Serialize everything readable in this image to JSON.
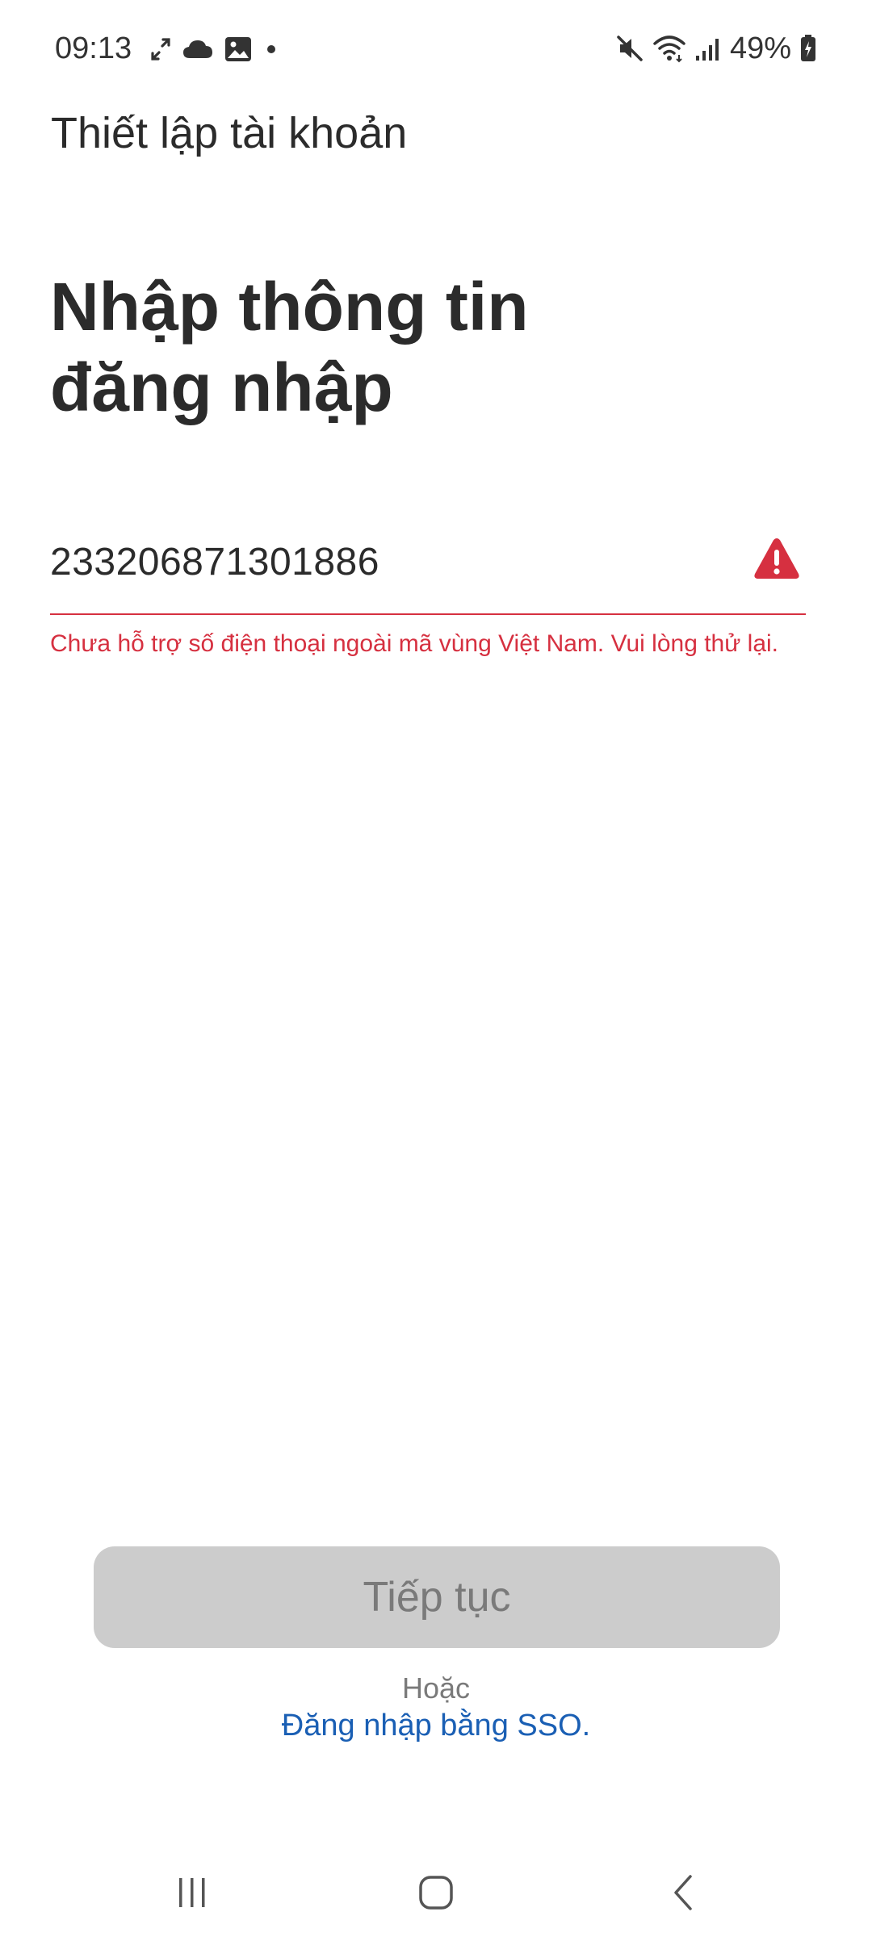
{
  "status_bar": {
    "time": "09:13",
    "battery": "49%",
    "left_icons": [
      "expand-arrows-icon",
      "cloud-icon",
      "gallery-icon",
      "notification-dot-icon"
    ],
    "right_icons": [
      "mute-icon",
      "wifi-icon",
      "signal-icon",
      "battery-icon"
    ]
  },
  "header": {
    "title": "Thiết lập tài khoản"
  },
  "main": {
    "title_line1": "Nhập thông tin",
    "title_line2": "đăng nhập",
    "input": {
      "value": "233206871301886",
      "placeholder": ""
    },
    "error_message": "Chưa hỗ trợ số điện thoại ngoài mã vùng Việt Nam. Vui lòng thử lại."
  },
  "actions": {
    "continue_label": "Tiếp tục",
    "or_label": "Hoặc",
    "sso_label": "Đăng nhập bằng SSO."
  },
  "colors": {
    "error": "#d63040",
    "link": "#1a5fb4",
    "button_disabled_bg": "#cccccc",
    "button_disabled_text": "#7a7a7a",
    "text_primary": "#2b2b2b"
  },
  "nav_bar": {
    "icons": [
      "recent-apps-icon",
      "home-icon",
      "back-icon"
    ]
  }
}
